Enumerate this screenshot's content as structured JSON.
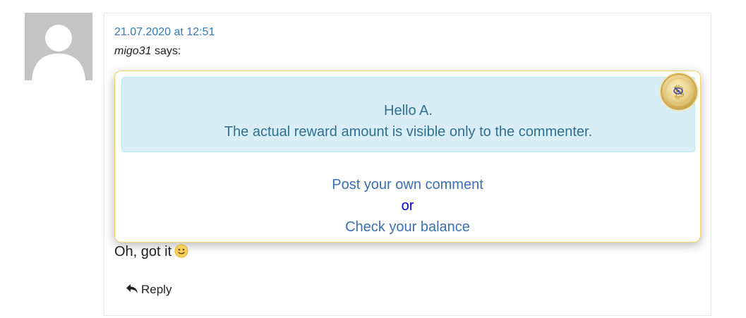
{
  "comment": {
    "date": "21.07.2020 at 12:51",
    "author": "migo31",
    "says": "says:",
    "text": "Oh, got it",
    "reply_label": "Reply"
  },
  "reward_box": {
    "greeting": "Hello A.",
    "message": "The actual reward amount is visible only to the commenter.",
    "post_comment_link": "Post your own comment",
    "or_text": "or",
    "check_balance_link": "Check your balance",
    "coin_symbol": "₿"
  },
  "icons": {
    "avatar": "default-avatar-icon",
    "coin": "bitcoin-coin-icon",
    "smiley": "smiley-emoji-icon",
    "reply": "reply-arrow-icon"
  },
  "colors": {
    "link_blue": "#337ab7",
    "info_background": "#d9edf7",
    "info_text": "#31708f",
    "popup_border": "#f0d36a",
    "or_text": "#0000ee"
  }
}
